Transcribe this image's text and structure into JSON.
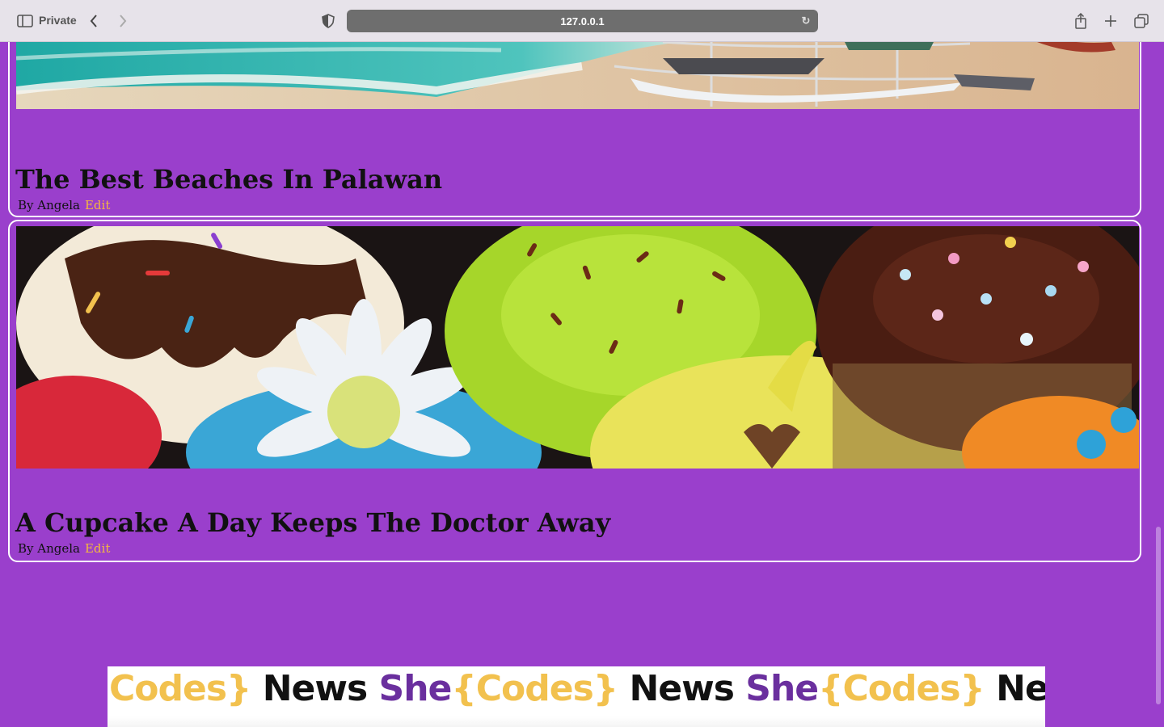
{
  "browser": {
    "private_label": "Private",
    "url": "127.0.0.1"
  },
  "posts": [
    {
      "title": "The Best Beaches In Palawan",
      "author": "By Angela",
      "edit_label": "Edit"
    },
    {
      "title": "A Cupcake A Day Keeps The Doctor Away",
      "author": "By Angela",
      "edit_label": "Edit"
    }
  ],
  "banner": {
    "segments": [
      "Codes}",
      "News",
      "She",
      "{Codes}",
      "News",
      "She",
      "{Codes}",
      "News"
    ]
  },
  "colors": {
    "page_bg": "#9a3fcc",
    "edit_link": "#f4b93e",
    "logo_yellow": "#f2c14e",
    "logo_purple": "#6a2f9e"
  }
}
